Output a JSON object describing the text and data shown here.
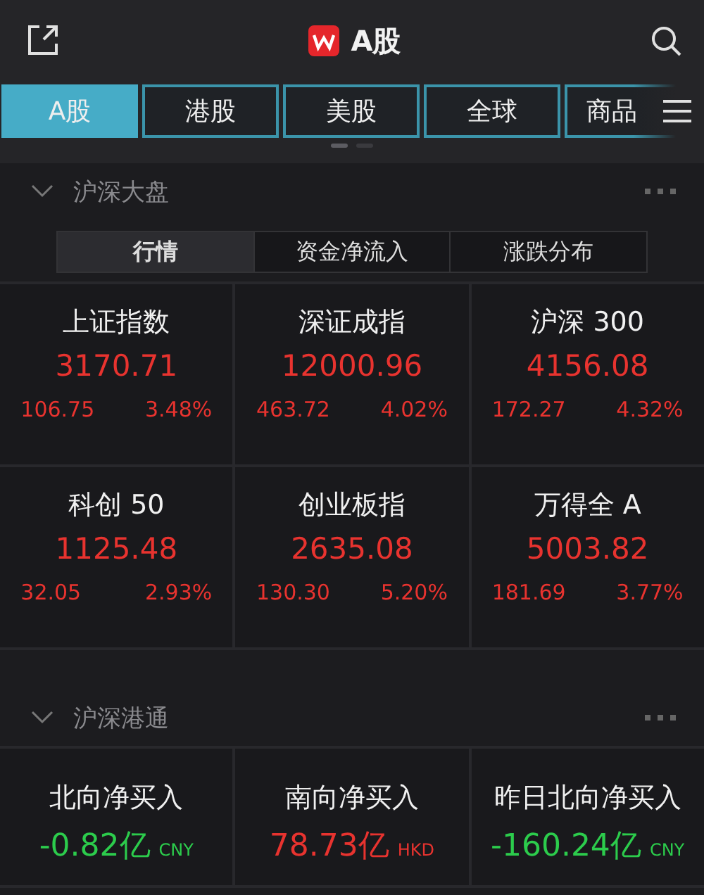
{
  "header": {
    "title": "A股"
  },
  "market_tabs": [
    {
      "label": "A股",
      "selected": true
    },
    {
      "label": "港股",
      "selected": false
    },
    {
      "label": "美股",
      "selected": false
    },
    {
      "label": "全球",
      "selected": false
    },
    {
      "label": "商品",
      "selected": false
    }
  ],
  "pages": [
    {
      "selected": true
    },
    {
      "selected": false
    }
  ],
  "sections": [
    {
      "title": "沪深大盘",
      "expanded": true,
      "kind": "indices",
      "subtabs": [
        {
          "label": "行情",
          "selected": true
        },
        {
          "label": "资金净流入",
          "selected": false
        },
        {
          "label": "涨跌分布",
          "selected": false
        }
      ],
      "cards": [
        {
          "name": "上证指数",
          "price": "3170.71",
          "change": "106.75",
          "percent": "3.48%",
          "color": "#e8332f"
        },
        {
          "name": "深证成指",
          "price": "12000.96",
          "change": "463.72",
          "percent": "4.02%",
          "color": "#e8332f"
        },
        {
          "name": "沪深 300",
          "price": "4156.08",
          "change": "172.27",
          "percent": "4.32%",
          "color": "#e8332f"
        },
        {
          "name": "科创 50",
          "price": "1125.48",
          "change": "32.05",
          "percent": "2.93%",
          "color": "#e8332f"
        },
        {
          "name": "创业板指",
          "price": "2635.08",
          "change": "130.30",
          "percent": "5.20%",
          "color": "#e8332f"
        },
        {
          "name": "万得全 A",
          "price": "5003.82",
          "change": "181.69",
          "percent": "3.77%",
          "color": "#e8332f"
        }
      ]
    },
    {
      "title": "沪深港通",
      "expanded": true,
      "kind": "flows",
      "cards": [
        {
          "name": "北向净买入",
          "value": "-0.82亿",
          "currency": "CNY",
          "color": "#2ccc4c"
        },
        {
          "name": "南向净买入",
          "value": "78.73亿",
          "currency": "HKD",
          "color": "#e8332f"
        },
        {
          "name": "昨日北向净买入",
          "value": "-160.24亿",
          "currency": "CNY",
          "color": "#2ccc4c"
        }
      ]
    }
  ]
}
